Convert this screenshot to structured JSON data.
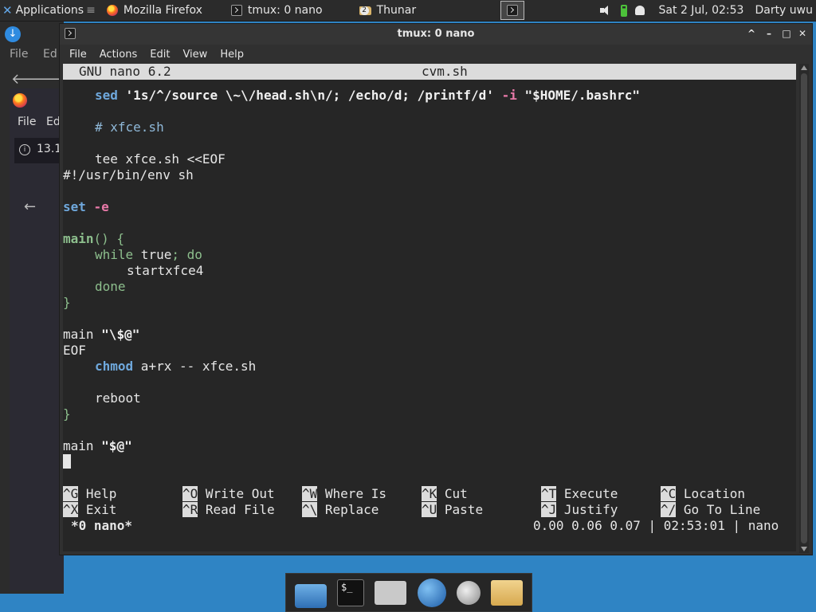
{
  "top_panel": {
    "applications_label": "Applications",
    "tasks": [
      {
        "label": "Mozilla Firefox",
        "icon": "firefox-icon"
      },
      {
        "label": "tmux: 0 nano",
        "icon": "terminal-icon"
      },
      {
        "label": "Thunar",
        "icon": "folder-icon",
        "badge": "2"
      }
    ],
    "clock": "Sat  2 Jul, 02:53",
    "user": "Darty uwu"
  },
  "background": {
    "file_menu": "File",
    "edit_menu": "Ed",
    "ff_file_menu": "File",
    "ff_edit_menu": "Ed",
    "ff_info_text": "13.1"
  },
  "window": {
    "title": "tmux: 0 nano",
    "menu": [
      "File",
      "Actions",
      "Edit",
      "View",
      "Help"
    ]
  },
  "nano": {
    "version": "GNU nano 6.2",
    "filename": "cvm.sh",
    "shortcuts": [
      {
        "key": "^G",
        "label": "Help"
      },
      {
        "key": "^O",
        "label": "Write Out"
      },
      {
        "key": "^W",
        "label": "Where Is"
      },
      {
        "key": "^K",
        "label": "Cut"
      },
      {
        "key": "^T",
        "label": "Execute"
      },
      {
        "key": "^C",
        "label": "Location"
      },
      {
        "key": "^X",
        "label": "Exit"
      },
      {
        "key": "^R",
        "label": "Read File"
      },
      {
        "key": "^\\",
        "label": "Replace"
      },
      {
        "key": "^U",
        "label": "Paste"
      },
      {
        "key": "^J",
        "label": "Justify"
      },
      {
        "key": "^/",
        "label": "Go To Line"
      }
    ]
  },
  "tmux_status": {
    "session": "*0 nano*",
    "right": "0.00 0.06 0.07 | 02:53:01 | nano"
  },
  "code": {
    "l1_cmd": "sed",
    "l1_arg": "'1s/^/source \\~\\/head.sh\\n/; /echo/d; /printf/d'",
    "l1_flag": "-i",
    "l1_file": "\"$HOME/.bashrc\"",
    "l2": "# xfce.sh",
    "l3": "tee xfce.sh <<EOF",
    "l4": "#!/usr/bin/env sh",
    "l5_kw": "set",
    "l5_flag": "-e",
    "l6_fn": "main",
    "l6_rest": "() {",
    "l7_kw": "while",
    "l7_mid": " true",
    "l7_end": "; do",
    "l8": "startxfce4",
    "l9": "done",
    "l10": "}",
    "l11_a": "main ",
    "l11_b": "\"\\$@\"",
    "l12": "EOF",
    "l13_kw": "chmod",
    "l13_rest": " a+rx -- xfce.sh",
    "l14": "reboot",
    "l15": "}",
    "l16_a": "main ",
    "l16_b": "\"$@\""
  }
}
